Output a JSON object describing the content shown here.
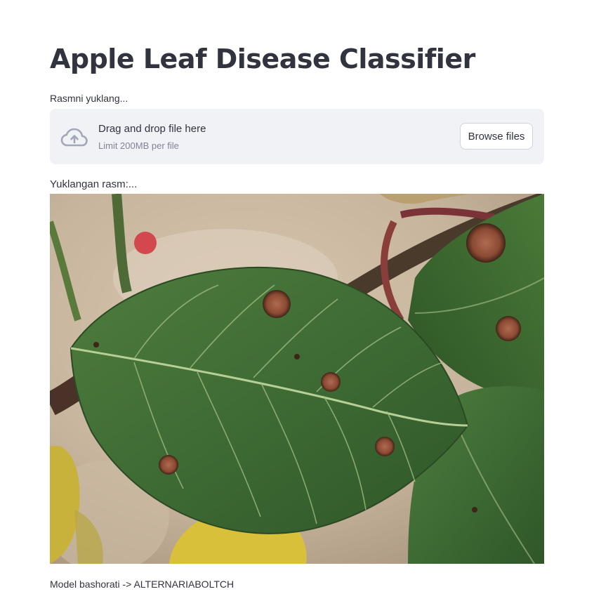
{
  "app": {
    "title": "Apple Leaf Disease Classifier"
  },
  "uploader": {
    "label": "Rasmni yuklang...",
    "drop_text": "Drag and drop file here",
    "limit_text": "Limit 200MB per file",
    "browse_label": "Browse files",
    "icon": "cloud-upload-icon"
  },
  "image_section": {
    "label": "Yuklangan rasm:..."
  },
  "result": {
    "prefix": "Model bashorati -> ",
    "prediction": "ALTERNARIABOLTCH"
  },
  "colors": {
    "dropzone_bg": "#f0f2f6",
    "text": "#31333f",
    "muted": "#808495",
    "leaf": "#3e6b34",
    "lesion": "#8b4a32"
  }
}
